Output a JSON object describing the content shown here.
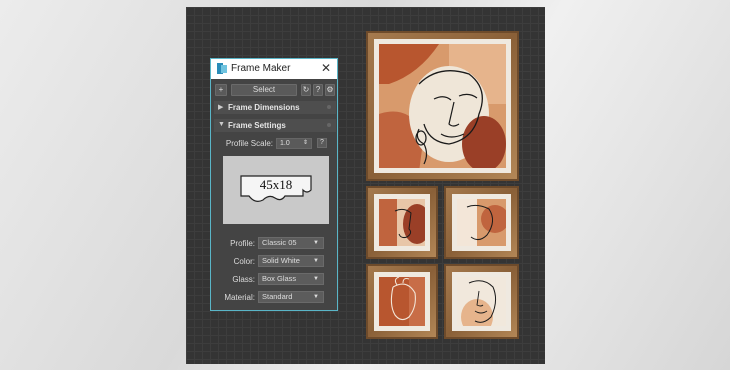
{
  "dialog": {
    "title": "Frame Maker",
    "toolbar": {
      "add_label": "+",
      "select_label": "Select",
      "help_label": "?"
    },
    "sections": {
      "dimensions": "Frame Dimensions",
      "settings": "Frame Settings"
    },
    "profile_scale": {
      "label": "Profile Scale:",
      "value": "1.0",
      "help": "?"
    },
    "preview_text": "45x18",
    "fields": [
      {
        "label": "Profile:",
        "value": "Classic 05"
      },
      {
        "label": "Color:",
        "value": "Solid White"
      },
      {
        "label": "Glass:",
        "value": "Box Glass"
      },
      {
        "label": "Material:",
        "value": "Standard"
      }
    ]
  },
  "colors": {
    "accent_border": "#5ab6c8",
    "frame_wood": "#9a6e44",
    "art_terracotta": "#c0643e",
    "art_peach": "#e6b48c"
  }
}
